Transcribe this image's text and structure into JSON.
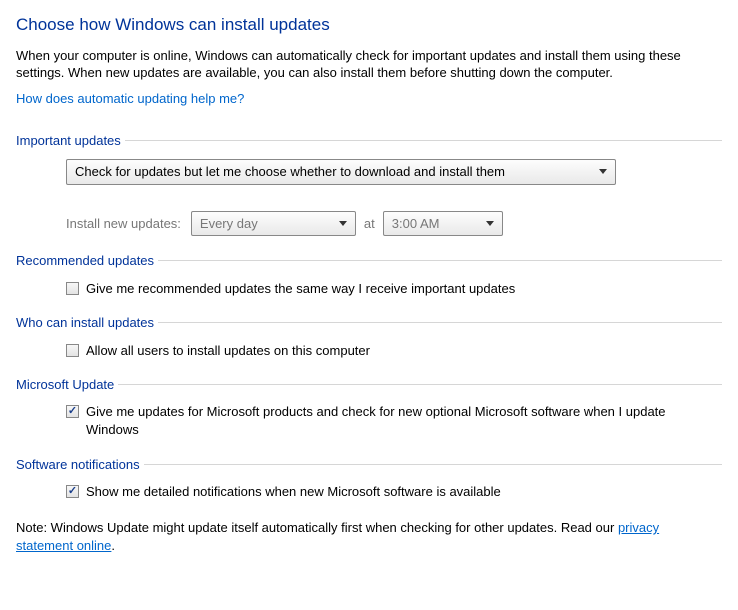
{
  "title": "Choose how Windows can install updates",
  "description": "When your computer is online, Windows can automatically check for important updates and install them using these settings. When new updates are available, you can also install them before shutting down the computer.",
  "help_link": "How does automatic updating help me?",
  "sections": {
    "important": {
      "header": "Important updates",
      "dropdown_value": "Check for updates but let me choose whether to download and install them",
      "schedule_label": "Install new updates:",
      "schedule_frequency": "Every day",
      "schedule_at": "at",
      "schedule_time": "3:00 AM"
    },
    "recommended": {
      "header": "Recommended updates",
      "checkbox_label": "Give me recommended updates the same way I receive important updates",
      "checked": false
    },
    "who": {
      "header": "Who can install updates",
      "checkbox_label": "Allow all users to install updates on this computer",
      "checked": false
    },
    "microsoft": {
      "header": "Microsoft Update",
      "checkbox_label": "Give me updates for Microsoft products and check for new optional Microsoft software when I update Windows",
      "checked": true
    },
    "notifications": {
      "header": "Software notifications",
      "checkbox_label": "Show me detailed notifications when new Microsoft software is available",
      "checked": true
    }
  },
  "footer": {
    "note_prefix": "Note: Windows Update might update itself automatically first when checking for other updates.  Read our ",
    "link_text": "privacy statement online",
    "note_suffix": "."
  }
}
